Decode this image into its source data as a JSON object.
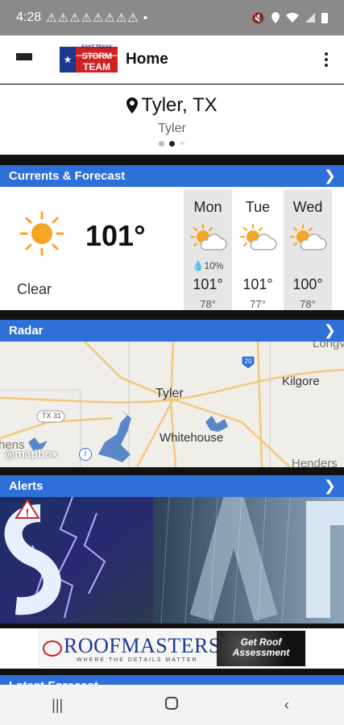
{
  "status_bar": {
    "time": "4:28",
    "warnings": "⚠⚠⚠⚠⚠⚠⚠⚠ •"
  },
  "app_bar": {
    "title": "Home",
    "logo_text": {
      "line1": "EAST TEXAS",
      "line2": "STORM",
      "line3": "TEAM"
    }
  },
  "location": {
    "city": "Tyler, TX",
    "subtitle": "Tyler",
    "page_count": 3,
    "active_page": 2
  },
  "sections": {
    "currents": "Currents & Forecast",
    "radar": "Radar",
    "alerts": "Alerts",
    "latest": "Latest Forecast"
  },
  "current": {
    "temp": "101°",
    "condition": "Clear"
  },
  "forecast": [
    {
      "day": "Mon",
      "precip": "10%",
      "hi": "101°",
      "lo": "78°"
    },
    {
      "day": "Tue",
      "precip": "",
      "hi": "101°",
      "lo": "77°"
    },
    {
      "day": "Wed",
      "precip": "",
      "hi": "100°",
      "lo": "78°"
    }
  ],
  "radar_labels": {
    "tyler": "Tyler",
    "whitehouse": "Whitehouse",
    "kilgore": "Kilgore",
    "longview": "Longv",
    "henderson": "Henders",
    "tx31": "TX 31",
    "i20": "20",
    "jacksonville": "hens",
    "mapbox": "mapbox"
  },
  "ad": {
    "brand": "ROOFMASTERS",
    "tagline": "WHERE THE DETAILS MATTER",
    "cta": "Get Roof Assessment"
  },
  "colors": {
    "accent": "#2f6fd8",
    "sun": "#f5a623"
  }
}
